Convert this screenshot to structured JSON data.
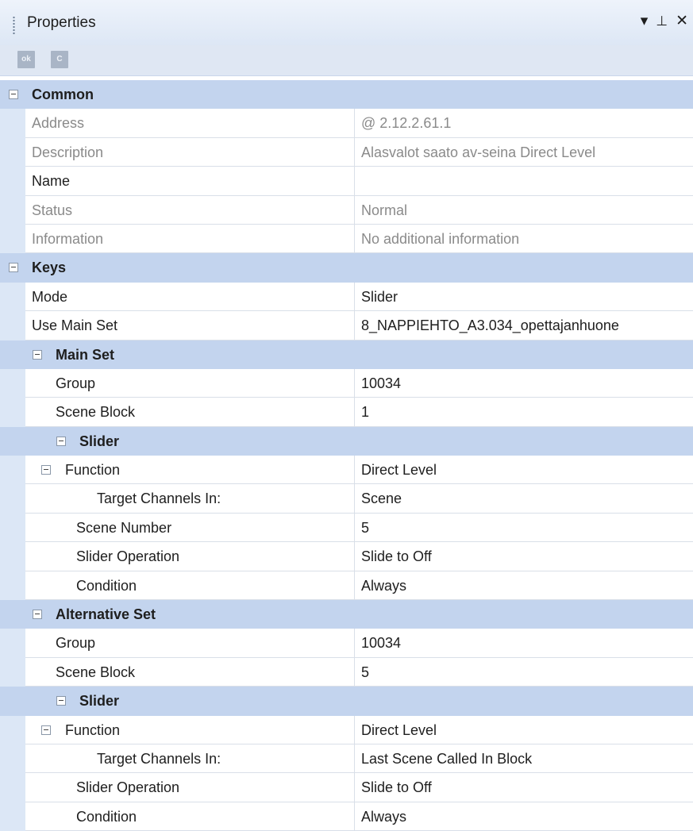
{
  "panel": {
    "title": "Properties",
    "controls": {
      "dropdown": "▾",
      "pin": "⊥",
      "close": "✕"
    }
  },
  "toolbar": {
    "ok_label": "ok",
    "cancel_label": "C"
  },
  "rows": [
    {
      "kind": "category",
      "level": 0,
      "label": "Common",
      "toggle": true
    },
    {
      "kind": "readonly",
      "level": 1,
      "label": "Address",
      "value": "@ 2.12.2.61.1"
    },
    {
      "kind": "readonly",
      "level": 1,
      "label": "Description",
      "value": "Alasvalot saato av-seina Direct Level"
    },
    {
      "kind": "editable",
      "level": 1,
      "label": "Name",
      "value": ""
    },
    {
      "kind": "readonly",
      "level": 1,
      "label": "Status",
      "value": "Normal"
    },
    {
      "kind": "readonly",
      "level": 1,
      "label": "Information",
      "value": "No additional information"
    },
    {
      "kind": "category",
      "level": 0,
      "label": "Keys",
      "toggle": true
    },
    {
      "kind": "editable",
      "level": 1,
      "label": "Mode",
      "value": "Slider"
    },
    {
      "kind": "editable",
      "level": 1,
      "label": "Use Main Set",
      "value": "8_NAPPIEHTO_A3.034_opettajanhuone"
    },
    {
      "kind": "category",
      "level": 1,
      "label": "Main Set",
      "toggle": true
    },
    {
      "kind": "editable",
      "level": 2,
      "label": "Group",
      "value": "10034"
    },
    {
      "kind": "editable",
      "level": 2,
      "label": "Scene Block",
      "value": "1"
    },
    {
      "kind": "category",
      "level": 2,
      "label": "Slider",
      "toggle": true
    },
    {
      "kind": "editable",
      "level": 2,
      "label": "Function",
      "value": "Direct Level",
      "toggle": true
    },
    {
      "kind": "editable",
      "level": 3,
      "label": "Target Channels In:",
      "value": "Scene"
    },
    {
      "kind": "editable",
      "level": 2.5,
      "label": "Scene Number",
      "value": "5"
    },
    {
      "kind": "editable",
      "level": 2.5,
      "label": "Slider Operation",
      "value": "Slide to Off"
    },
    {
      "kind": "editable",
      "level": 2.5,
      "label": "Condition",
      "value": "Always"
    },
    {
      "kind": "category",
      "level": 1,
      "label": "Alternative Set",
      "toggle": true
    },
    {
      "kind": "editable",
      "level": 2,
      "label": "Group",
      "value": "10034"
    },
    {
      "kind": "editable",
      "level": 2,
      "label": "Scene Block",
      "value": "5"
    },
    {
      "kind": "category",
      "level": 2,
      "label": "Slider",
      "toggle": true
    },
    {
      "kind": "editable",
      "level": 2,
      "label": "Function",
      "value": "Direct Level",
      "toggle": true
    },
    {
      "kind": "editable",
      "level": 3,
      "label": "Target Channels In:",
      "value": "Last Scene Called In Block"
    },
    {
      "kind": "editable",
      "level": 2.5,
      "label": "Slider Operation",
      "value": "Slide to Off"
    },
    {
      "kind": "editable",
      "level": 2.5,
      "label": "Condition",
      "value": "Always"
    }
  ]
}
